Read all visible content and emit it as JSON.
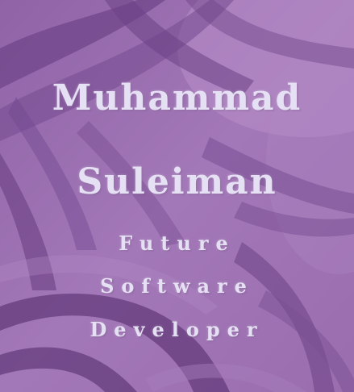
{
  "background": {
    "base_color": "#9a6fae",
    "dark_stroke_color": "#6e4484",
    "light_stroke_color": "#b48ac6"
  },
  "heading": {
    "first_name": "Muhammad",
    "last_name": "Suleiman"
  },
  "subtitle": {
    "line1": "Future",
    "line2": "Software",
    "line3": "Developer"
  },
  "text_color": "#e6e0f4"
}
